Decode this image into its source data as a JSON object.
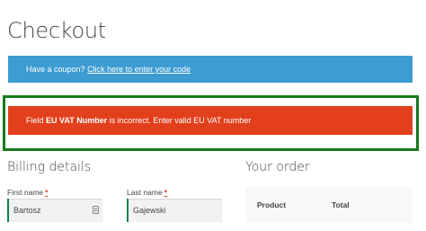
{
  "page": {
    "title": "Checkout"
  },
  "coupon": {
    "prompt": "Have a coupon?",
    "link": "Click here to enter your code"
  },
  "error": {
    "prefix": "Field",
    "field": "EU VAT Number",
    "suffix": "is incorrect. Enter valid EU VAT number"
  },
  "billing": {
    "title": "Billing details",
    "first_name": {
      "label": "First name",
      "required": "*",
      "value": "Bartosz"
    },
    "last_name": {
      "label": "Last name",
      "required": "*",
      "value": "Gajewski"
    }
  },
  "order": {
    "title": "Your order",
    "columns": [
      "Product",
      "Total"
    ]
  },
  "colors": {
    "info": "#3d9cd2",
    "error": "#e2401c",
    "highlight_frame": "#1b7a1b",
    "valid_field": "#0f834d"
  }
}
